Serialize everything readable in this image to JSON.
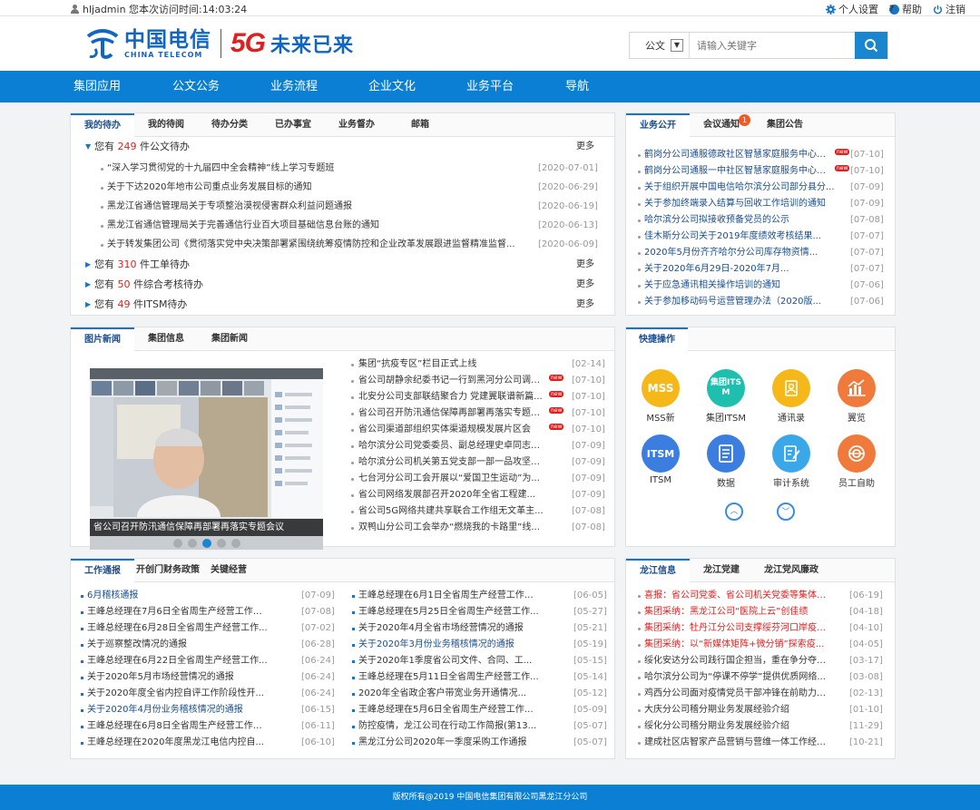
{
  "topbar": {
    "user_info": "hljadmin 您本次访问时间:14:03:24",
    "settings": "个人设置",
    "help": "帮助",
    "logout": "注销"
  },
  "header": {
    "logo_cn": "中国电信",
    "logo_en": "CHINA TELECOM",
    "logo_5g": "5G",
    "slogan": "未来已来",
    "search": {
      "scope": "公文",
      "placeholder": "请输入关键字"
    }
  },
  "nav": [
    "集团应用",
    "公文公务",
    "业务流程",
    "企业文化",
    "业务平台",
    "导航"
  ],
  "todo_panel": {
    "tabs": [
      "我的待办",
      "我的待阅",
      "待办分类",
      "已办事宜",
      "业务督办",
      "邮箱"
    ],
    "groups": [
      {
        "prefix": "您有",
        "count": "249",
        "suffix": "件公文待办",
        "more": "更多"
      },
      {
        "prefix": "您有",
        "count": "310",
        "suffix": "件工单待办",
        "more": "更多"
      },
      {
        "prefix": "您有",
        "count": "50",
        "suffix": "件综合考核待办",
        "more": "更多"
      },
      {
        "prefix": "您有",
        "count": "49",
        "suffix": "件ITSM待办",
        "more": "更多"
      }
    ],
    "items": [
      {
        "title": "“深入学习贯彻党的十九届四中全会精神”线上学习专题班",
        "date": "[2020-07-01]"
      },
      {
        "title": "关于下达2020年地市公司重点业务发展目标的通知",
        "date": "[2020-06-29]"
      },
      {
        "title": "黑龙江省通信管理局关于专项整治漠视侵害群众利益问题通报",
        "date": "[2020-06-19]"
      },
      {
        "title": "黑龙江省通信管理局关于完善通信行业百大项目基础信息台账的通知",
        "date": "[2020-06-13]"
      },
      {
        "title": "关于转发集团公司《贯彻落实党中央决策部署紧围绕统筹疫情防控和企业改革发展跟进监督精准监督...",
        "date": "[2020-06-09]"
      }
    ]
  },
  "affairs_panel": {
    "tabs": [
      "业务公开",
      "会议通知",
      "集团公告"
    ],
    "notification_badge": "1",
    "new_label": "new",
    "items": [
      {
        "title": "鹤岗分公司通服德政社区智慧家庭服务中心营...",
        "date": "[07-10]",
        "new": true
      },
      {
        "title": "鹤岗分公司通服一中社区智慧家庭服务中心营...",
        "date": "[07-10]",
        "new": true
      },
      {
        "title": "关于组织开展中国电信哈尔滨分公司部分县分...",
        "date": "[07-09]",
        "new": false
      },
      {
        "title": "关于参加终端录入结算与回收工作培训的通知",
        "date": "[07-09]",
        "new": false
      },
      {
        "title": "哈尔滨分公司拟接收预备党员的公示",
        "date": "[07-08]",
        "new": false
      },
      {
        "title": "佳木斯分公司关于2019年度绩效考核结果...",
        "date": "[07-07]",
        "new": false
      },
      {
        "title": "2020年5月份齐齐哈尔分公司库存物资情...",
        "date": "[07-07]",
        "new": false
      },
      {
        "title": "关于2020年6月29日-2020年7月...",
        "date": "[07-07]",
        "new": false
      },
      {
        "title": "关于应急通讯相关操作培训的通知",
        "date": "[07-06]",
        "new": false
      },
      {
        "title": "关于参加移动码号运营管理办法（2020版...",
        "date": "[07-06]",
        "new": false
      }
    ]
  },
  "news_panel": {
    "tabs": [
      "图片新闻",
      "集团信息",
      "集团新闻"
    ],
    "caption": "省公司召开防汛通信保障再部署再落实专题会议",
    "items": [
      {
        "title": "集团“抗疫专区”栏目正式上线",
        "date": "[02-14]",
        "new": false
      },
      {
        "title": "省公司胡静余纪委书记一行到黑河分公司调研...",
        "date": "[07-10]",
        "new": true
      },
      {
        "title": "北安分公司支部联结聚合力 党建翼联谱新篇...",
        "date": "[07-10]",
        "new": true
      },
      {
        "title": "省公司召开防汛通信保障再部署再落实专题会...",
        "date": "[07-10]",
        "new": true
      },
      {
        "title": "省公司渠道部组织实体渠道规模发展片区会",
        "date": "[07-10]",
        "new": true
      },
      {
        "title": "哈尔滨分公司党委委员、副总经理史卓同志赴...",
        "date": "[07-09]",
        "new": false
      },
      {
        "title": "哈尔滨分公司机关第五党支部一部一品攻坚显...",
        "date": "[07-09]",
        "new": false
      },
      {
        "title": "七台河分公司工会开展以“爱国卫生运动”为...",
        "date": "[07-09]",
        "new": false
      },
      {
        "title": "省公司网络发展部召开2020年全省工程建...",
        "date": "[07-09]",
        "new": false
      },
      {
        "title": "省公司5G网络共建共享联合工作组无文革主...",
        "date": "[07-08]",
        "new": false
      },
      {
        "title": "双鸭山分公司工会举办“燃烧我的卡路里”线...",
        "date": "[07-08]",
        "new": false
      }
    ]
  },
  "quick_panel": {
    "title": "快捷操作",
    "items": [
      {
        "label": "MSS新",
        "icon": "MSS",
        "color": "#f5b818",
        "name": "mss-icon"
      },
      {
        "label": "集团ITSM",
        "icon": "集团ITSM",
        "color": "#1fbfb0",
        "name": "itsm-group-icon"
      },
      {
        "label": "通讯录",
        "icon": "",
        "color": "#f5b818",
        "name": "contacts-icon"
      },
      {
        "label": "翼览",
        "icon": "",
        "color": "#f07a3c",
        "name": "chart-icon"
      },
      {
        "label": "ITSM",
        "icon": "ITSM",
        "color": "#3b7ee0",
        "name": "itsm-icon"
      },
      {
        "label": "数据",
        "icon": "",
        "color": "#3b7ee0",
        "name": "data-doc-icon"
      },
      {
        "label": "审计系统",
        "icon": "",
        "color": "#3aa7e8",
        "name": "audit-edit-icon"
      },
      {
        "label": "员工自助",
        "icon": "",
        "color": "#f07a3c",
        "name": "self-service-icon"
      }
    ]
  },
  "work_panel": {
    "tabs": [
      "工作通报",
      "开创门财务政策",
      "关键经营"
    ],
    "left": [
      {
        "title": "6月稽核通报",
        "date": "[07-09]",
        "hl": true
      },
      {
        "title": "王峰总经理在7月6日全省周生产经营工作调...",
        "date": "[07-08]",
        "hl": false
      },
      {
        "title": "王峰总经理在6月28日全省周生产经营工作...",
        "date": "[07-02]",
        "hl": false
      },
      {
        "title": "关于巡察整改情况的通报",
        "date": "[06-28]",
        "hl": false
      },
      {
        "title": "王峰总经理在6月22日全省周生产经营工作...",
        "date": "[06-24]",
        "hl": false
      },
      {
        "title": "关于2020年5月市场经营情况的通报",
        "date": "[06-24]",
        "hl": false
      },
      {
        "title": "关于2020年度全省内控自评工作阶段性开...",
        "date": "[06-24]",
        "hl": false
      },
      {
        "title": "关于2020年4月份业务稽核情况的通报",
        "date": "[06-15]",
        "hl": true
      },
      {
        "title": "王峰总经理在6月8日全省周生产经营工作调...",
        "date": "[06-11]",
        "hl": false
      },
      {
        "title": "王峰总经理在2020年度黑龙江电信内控自...",
        "date": "[06-10]",
        "hl": false
      }
    ],
    "right": [
      {
        "title": "王峰总经理在6月1日全省周生产经营工作调...",
        "date": "[06-05]",
        "hl": false
      },
      {
        "title": "王峰总经理在5月25日全省周生产经营工作...",
        "date": "[05-27]",
        "hl": false
      },
      {
        "title": "关于2020年4月全省市场经营情况的通报",
        "date": "[05-21]",
        "hl": false
      },
      {
        "title": "关于2020年3月份业务稽核情况的通报",
        "date": "[05-19]",
        "hl": true
      },
      {
        "title": "关于2020年1季度省公司文件、合同、工...",
        "date": "[05-15]",
        "hl": false
      },
      {
        "title": "王峰总经理在5月11日全省周生产经营工作...",
        "date": "[05-14]",
        "hl": false
      },
      {
        "title": "2020年全省政企客户带宽业务开通情况...",
        "date": "[05-12]",
        "hl": false
      },
      {
        "title": "王峰总经理在5月6日全省周生产经营工作调...",
        "date": "[05-09]",
        "hl": false
      },
      {
        "title": "防控疫情，龙江公司在行动工作简报(第13...",
        "date": "[05-07]",
        "hl": false
      },
      {
        "title": "黑龙江分公司2020年一季度采购工作通报",
        "date": "[05-07]",
        "hl": false
      }
    ]
  },
  "longjiang_panel": {
    "tabs": [
      "龙江信息",
      "龙江党建",
      "龙江党风廉政"
    ],
    "items": [
      {
        "title": "喜报：省公司党委、省公司机关党委等集体及...",
        "date": "[06-19]",
        "red": true
      },
      {
        "title": "集团采纳：黑龙江公司“医院上云”创佳绩",
        "date": "[04-18]",
        "red": true
      },
      {
        "title": "集团采纳：牡丹江分公司支撑绥芬河口岸疫情...",
        "date": "[04-10]",
        "red": true
      },
      {
        "title": "集团采纳：以“新媒体矩阵+微分销”探索疫...",
        "date": "[04-05]",
        "red": true
      },
      {
        "title": "绥化安达分公司践行国企担当，重在争分夺秒...",
        "date": "[03-17]",
        "red": false
      },
      {
        "title": "哈尔滨分公司为“停课不停学”提供优质网络...",
        "date": "[03-08]",
        "red": false
      },
      {
        "title": "鸡西分公司面对疫情党员干部冲锋在前助力全...",
        "date": "[02-13]",
        "red": false
      },
      {
        "title": "大庆分公司稽分期业务发展经验介绍",
        "date": "[01-10]",
        "red": false
      },
      {
        "title": "绥化分公司稽分期业务发展经验介绍",
        "date": "[11-29]",
        "red": false
      },
      {
        "title": "建成社区店智家产品营销与营维一体工作经验...",
        "date": "[10-21]",
        "red": false
      }
    ]
  },
  "footer": {
    "copyright": "版权所有@2019 中国电信集团有限公司黑龙江分公司"
  }
}
